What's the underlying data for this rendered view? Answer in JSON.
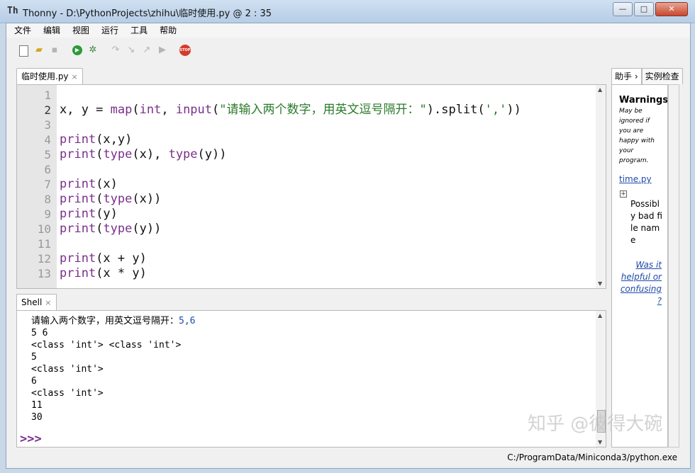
{
  "window": {
    "app_icon": "Th",
    "title": "Thonny  -  D:\\PythonProjects\\zhihu\\临时使用.py  @  2 : 35",
    "controls": [
      "—",
      "□",
      "✕"
    ]
  },
  "menu": [
    "文件",
    "编辑",
    "视图",
    "运行",
    "工具",
    "帮助"
  ],
  "toolbar": {
    "icons": [
      "new-file-icon",
      "open-folder-icon",
      "save-icon",
      "run-icon",
      "debug-icon",
      "step-over-icon",
      "step-into-icon",
      "step-out-icon",
      "resume-icon",
      "stop-icon"
    ],
    "stop_label": "STOP"
  },
  "editor": {
    "tab": "临时使用.py",
    "tab_close": "×",
    "current_line": 2,
    "lines": [
      {
        "n": "1",
        "parts": []
      },
      {
        "n": "2",
        "parts": [
          [
            "x, y = ",
            "p"
          ],
          [
            "map",
            "k"
          ],
          [
            "(",
            "p"
          ],
          [
            "int",
            "k"
          ],
          [
            ", ",
            "p"
          ],
          [
            "input",
            "k"
          ],
          [
            "(",
            "p"
          ],
          [
            "\"请输入两个数字，用英文逗号隔开：\"",
            "s"
          ],
          [
            ").split(",
            "p"
          ],
          [
            "','",
            "s"
          ],
          [
            "))",
            "p"
          ]
        ]
      },
      {
        "n": "3",
        "parts": []
      },
      {
        "n": "4",
        "parts": [
          [
            "print",
            "k"
          ],
          [
            "(x,y)",
            "p"
          ]
        ]
      },
      {
        "n": "5",
        "parts": [
          [
            "print",
            "k"
          ],
          [
            "(",
            "p"
          ],
          [
            "type",
            "k"
          ],
          [
            "(x), ",
            "p"
          ],
          [
            "type",
            "k"
          ],
          [
            "(y))",
            "p"
          ]
        ]
      },
      {
        "n": "6",
        "parts": []
      },
      {
        "n": "7",
        "parts": [
          [
            "print",
            "k"
          ],
          [
            "(x)",
            "p"
          ]
        ]
      },
      {
        "n": "8",
        "parts": [
          [
            "print",
            "k"
          ],
          [
            "(",
            "p"
          ],
          [
            "type",
            "k"
          ],
          [
            "(x))",
            "p"
          ]
        ]
      },
      {
        "n": "9",
        "parts": [
          [
            "print",
            "k"
          ],
          [
            "(y)",
            "p"
          ]
        ]
      },
      {
        "n": "10",
        "parts": [
          [
            "print",
            "k"
          ],
          [
            "(",
            "p"
          ],
          [
            "type",
            "k"
          ],
          [
            "(y))",
            "p"
          ]
        ]
      },
      {
        "n": "11",
        "parts": []
      },
      {
        "n": "12",
        "parts": [
          [
            "print",
            "k"
          ],
          [
            "(x + y)",
            "p"
          ]
        ]
      },
      {
        "n": "13",
        "parts": [
          [
            "print",
            "k"
          ],
          [
            "(x * y)",
            "p"
          ]
        ]
      }
    ]
  },
  "shell": {
    "tab": "Shell",
    "tab_close": "×",
    "prompt_text": "请输入两个数字，用英文逗号隔开：",
    "user_input": "5,6",
    "output": [
      "5 6",
      "<class 'int'> <class 'int'>",
      "5",
      "<class 'int'>",
      "6",
      "<class 'int'>",
      "11",
      "30"
    ],
    "prompt": ">>>"
  },
  "assistant": {
    "tabs": [
      "助手",
      "实例检查"
    ],
    "tab_chevron": "›",
    "warnings_title": "Warnings",
    "warnings_subtitle": "May be ignored if you are happy with your program.",
    "file_link": "time.py",
    "expand": "+",
    "item": "Possibly bad file name",
    "helpful": "Was it helpful or confusing ?"
  },
  "status": {
    "interpreter": "C:/ProgramData/Miniconda3/python.exe"
  },
  "watermark": "知乎 @彼得大碗",
  "colors": {
    "keyword": "#7a2f8a",
    "string": "#2b7a2b",
    "shell_input": "#1e4aa8"
  }
}
